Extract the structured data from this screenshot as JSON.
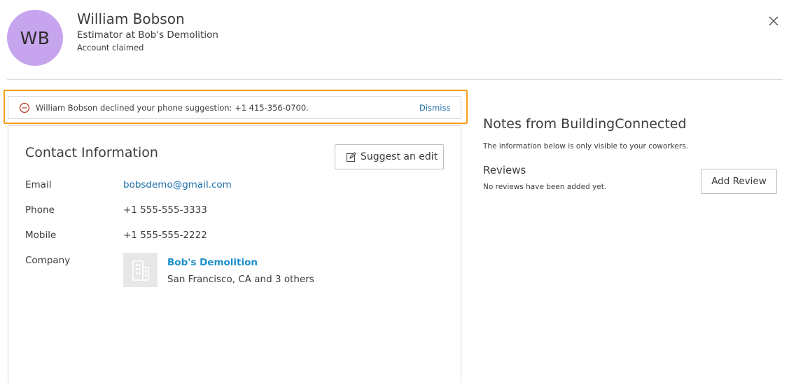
{
  "profile": {
    "initials": "WB",
    "name": "William Bobson",
    "title": "Estimator at Bob's Demolition",
    "status": "Account claimed",
    "avatar_color": "#c7a5ee"
  },
  "header": {
    "close_icon": "close-icon"
  },
  "alert": {
    "icon": "declined-circle-icon",
    "message": "William Bobson declined your phone suggestion: +1 415-356-0700.",
    "dismiss_label": "Dismiss",
    "highlight_color": "#f5a01a"
  },
  "contact": {
    "title": "Contact Information",
    "suggest_edit_label": "Suggest an edit",
    "suggest_edit_icon": "edit-icon",
    "fields": [
      {
        "label": "Email",
        "value": "bobsdemo@gmail.com"
      },
      {
        "label": "Phone",
        "value": "+1 555-555-3333"
      },
      {
        "label": "Mobile",
        "value": "+1 555-555-2222"
      },
      {
        "label": "Company",
        "value": ""
      }
    ],
    "company": {
      "name": "Bob's Demolition",
      "location": "San Francisco, CA and 3 others",
      "logo_icon": "building-icon"
    }
  },
  "notes": {
    "title": "Notes from BuildingConnected",
    "subtitle": "The information below is only visible to your coworkers.",
    "reviews_title": "Reviews",
    "reviews_empty": "No reviews have been added yet.",
    "add_review_label": "Add Review"
  },
  "colors": {
    "link": "#1b6ea8",
    "company_link": "#1b8fc9",
    "border": "#d9d9d9"
  }
}
